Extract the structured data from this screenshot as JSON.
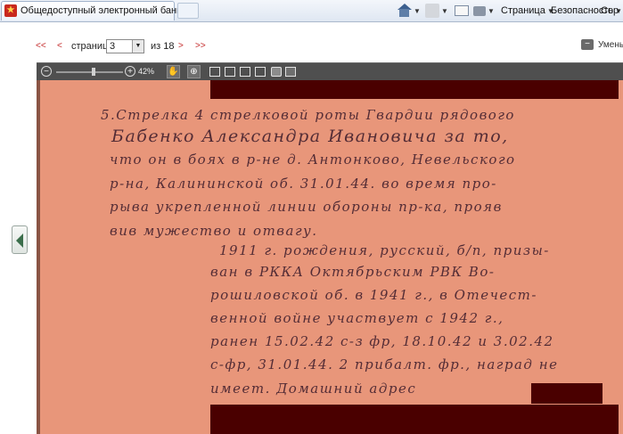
{
  "browser": {
    "tab_title": "Общедоступный электронный банк д...",
    "cmd_page": "Страница",
    "cmd_safety": "Безопасность",
    "cmd_service": "Сер"
  },
  "viewer": {
    "first": "<<",
    "prev": "<",
    "page_label": "страница",
    "page_value": "3",
    "of_label": "из 18",
    "next": ">",
    "last": ">>",
    "reduce_label": "Уменьш",
    "zoom_text": "42%",
    "zoom_level": 0.42
  },
  "document": {
    "lines": [
      "5.Стрелка 4 стрелковой роты Гвардии рядового",
      "Бабенко Александра Ивановича за то,",
      "что он в боях в р-не д. Антонково, Невельского",
      "р-на, Калининской об. 31.01.44. во время про-",
      "рыва укрепленной линии обороны пр-ка, прояв",
      "вив мужество и отвагу.",
      "1911 г. рождения, русский, б/п, призы-",
      "ван в РККА Октябрьским РВК Во-",
      "рошиловской об. в 1941 г., в Отечест-",
      "венной войне участвует с 1942 г.,",
      "ранен 15.02.42 с-з фр, 18.10.42 и 3.02.42",
      "с-фр, 31.01.44. 2 прибалт. фр., наград не",
      "имеет. Домашний адрес"
    ]
  }
}
